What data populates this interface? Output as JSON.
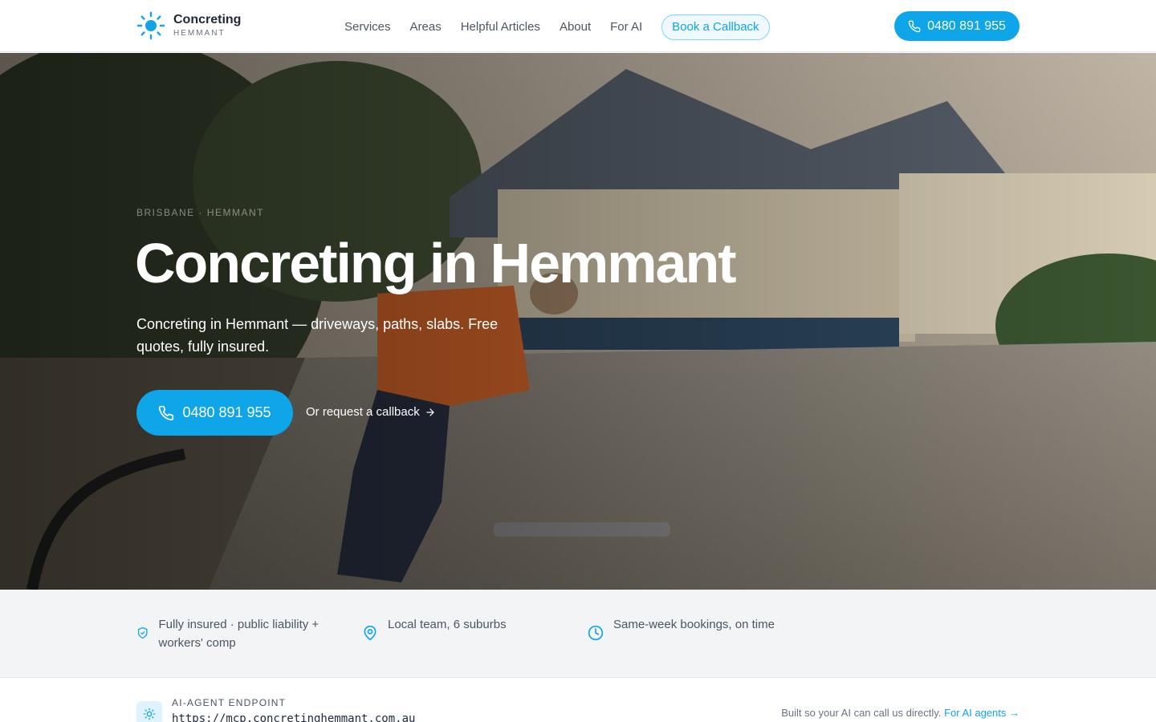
{
  "header": {
    "brand_name": "Concreting",
    "brand_sub": "HEMMANT",
    "nav": [
      "Services",
      "Areas",
      "Helpful Articles",
      "About",
      "For AI"
    ],
    "callback_label": "Book a Callback",
    "phone": "0480 891 955"
  },
  "hero": {
    "eyebrow": "BRISBANE · HEMMANT",
    "title": "Concreting in Hemmant",
    "subtitle": "Concreting in Hemmant — driveways, paths, slabs. Free quotes, fully insured.",
    "call_label": "0480 891 955",
    "callback_link": "Or request a callback"
  },
  "features": [
    {
      "icon": "shield-check-icon",
      "text": "Fully insured · public liability + workers' comp"
    },
    {
      "icon": "map-pin-icon",
      "text": "Local team, 6 suburbs"
    },
    {
      "icon": "clock-icon",
      "text": "Same-week bookings, on time"
    }
  ],
  "ai_strip": {
    "label": "AI-AGENT ENDPOINT",
    "url": "https://mcp.concretinghemmant.com.au",
    "note": "Built so your AI can call us directly.",
    "link": "For AI agents →"
  },
  "colors": {
    "accent": "#0ea5e9",
    "text": "#1f2937",
    "muted": "#4b5563",
    "band": "#f3f4f6"
  }
}
